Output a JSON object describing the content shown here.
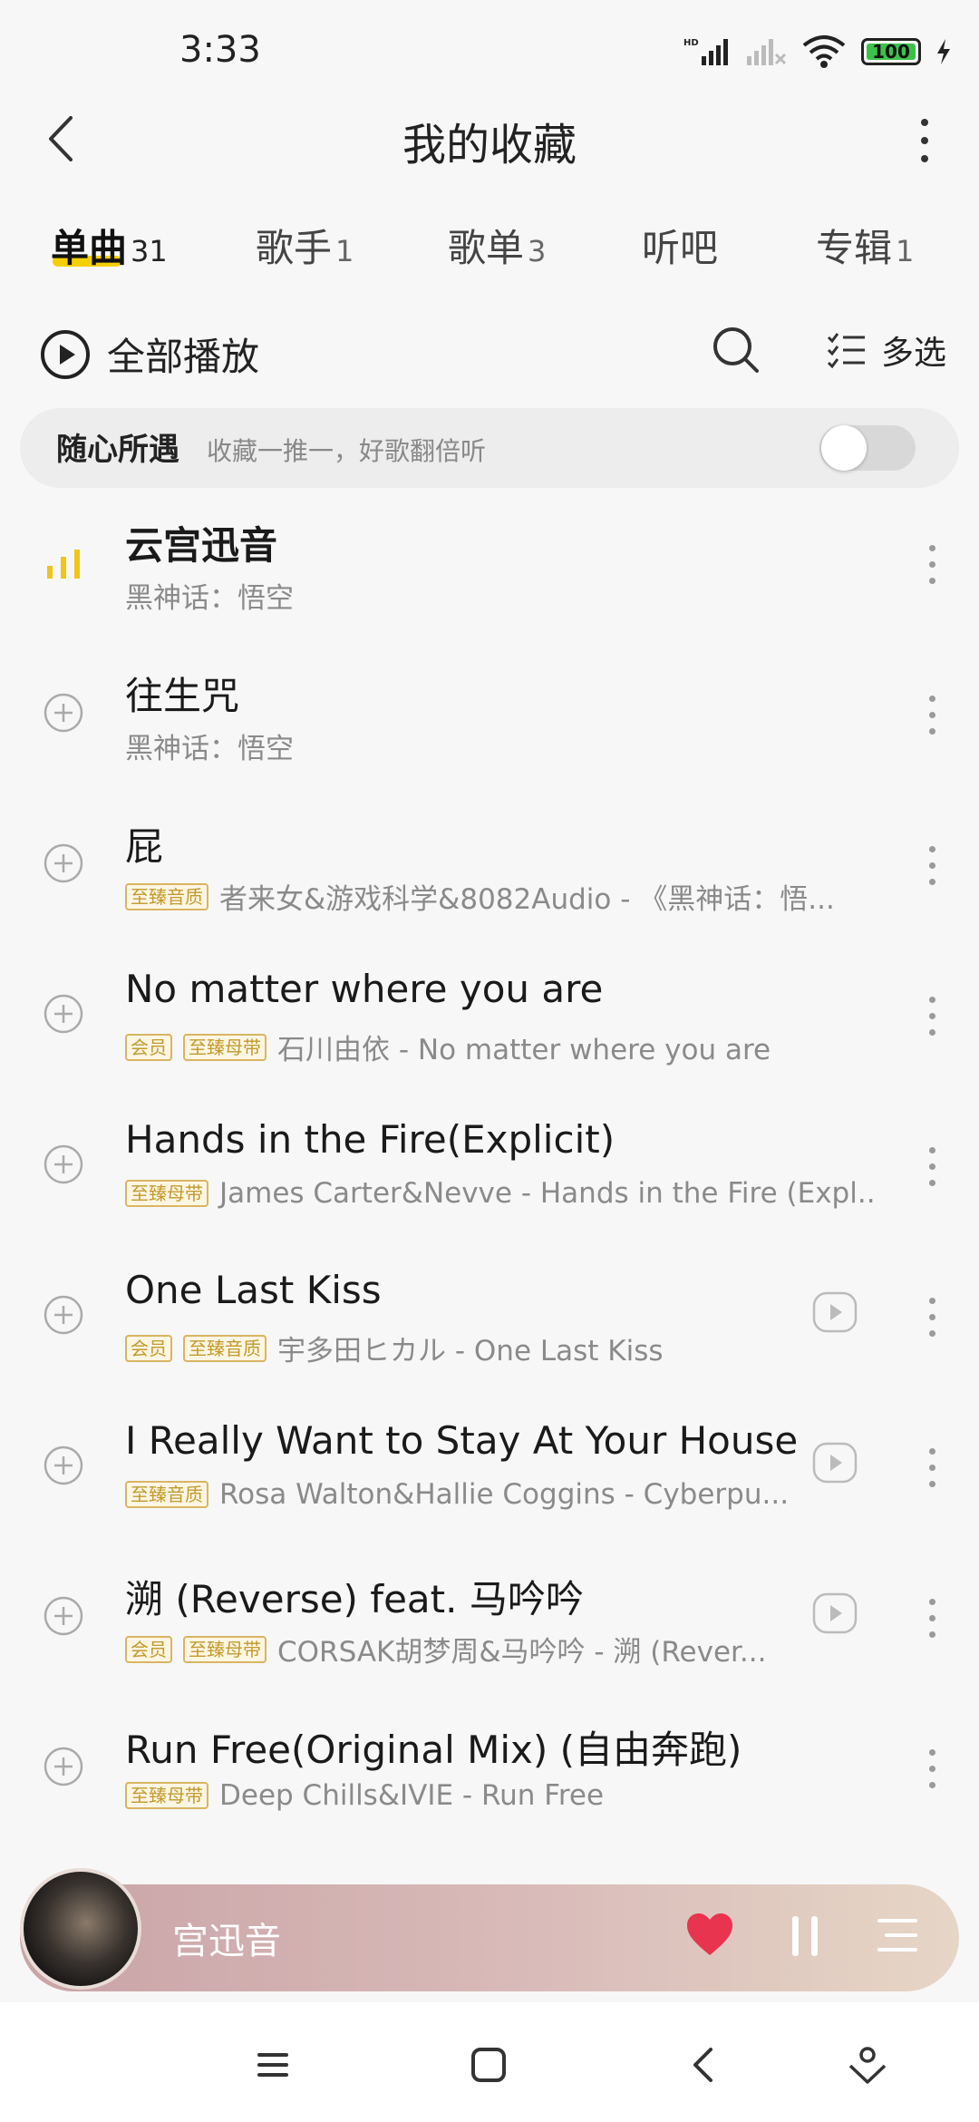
{
  "status": {
    "time": "3:33",
    "battery": "100"
  },
  "header": {
    "title": "我的收藏"
  },
  "tabs": [
    {
      "label": "单曲",
      "count": "31"
    },
    {
      "label": "歌手",
      "count": "1"
    },
    {
      "label": "歌单",
      "count": "3"
    },
    {
      "label": "听吧",
      "count": ""
    },
    {
      "label": "专辑",
      "count": "1"
    }
  ],
  "actions": {
    "play_all": "全部播放",
    "multi_select": "多选"
  },
  "banner": {
    "title": "随心所遇",
    "desc": "收藏一推一，好歌翻倍听"
  },
  "songs": [
    {
      "title": "云宫迅音",
      "tags": [],
      "meta": "黑神话：悟空"
    },
    {
      "title": "往生咒",
      "tags": [],
      "meta": "黑神话：悟空"
    },
    {
      "title": "屁",
      "tags": [
        "至臻音质"
      ],
      "meta": "者来女&游戏科学&8082Audio - 《黑神话：悟..."
    },
    {
      "title": "No matter where you are",
      "tags": [
        "会员",
        "至臻母带"
      ],
      "meta": "石川由依 - No matter where you are"
    },
    {
      "title": "Hands in the Fire(Explicit)",
      "tags": [
        "至臻母带"
      ],
      "meta": "James Carter&Nevve - Hands in the Fire (Expl..."
    },
    {
      "title": "One Last Kiss",
      "tags": [
        "会员",
        "至臻音质"
      ],
      "meta": "宇多田ヒカル - One Last Kiss"
    },
    {
      "title": "I Really Want to Stay At Your House",
      "tags": [
        "至臻音质"
      ],
      "meta": "Rosa Walton&Hallie Coggins - Cyberpu..."
    },
    {
      "title": "溯 (Reverse) feat. 马吟吟",
      "tags": [
        "会员",
        "至臻母带"
      ],
      "meta": "CORSAK胡梦周&马吟吟 - 溯 (Rever..."
    },
    {
      "title": "Run Free(Original Mix) (自由奔跑)",
      "tags": [
        "至臻母带"
      ],
      "meta": "Deep Chills&IVIE - Run Free"
    }
  ],
  "player": {
    "title": "宫迅音"
  },
  "colors": {
    "accent": "#f5d000",
    "tag": "#c49a2c",
    "heart": "#e8344e"
  }
}
